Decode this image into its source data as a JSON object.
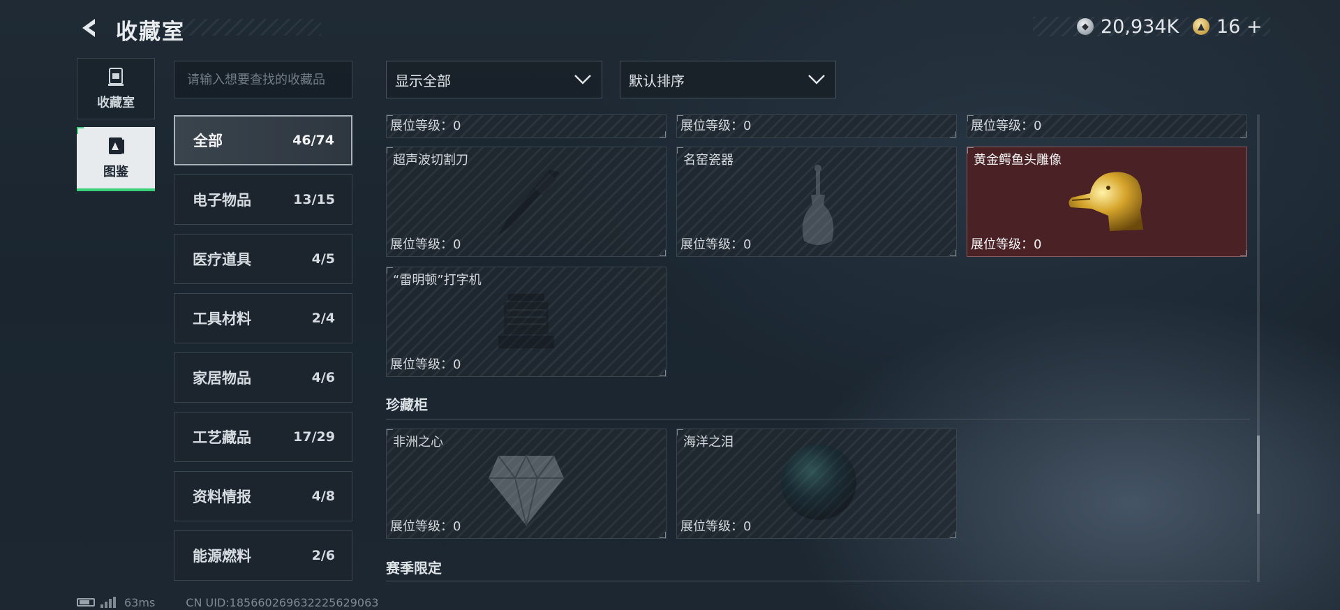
{
  "header": {
    "title": "收藏室",
    "currencies": [
      {
        "icon": "silver-coin-icon",
        "value": "20,934K"
      },
      {
        "icon": "gold-coin-icon",
        "value": "16 +"
      }
    ]
  },
  "left_nav": [
    {
      "icon": "trophy-icon",
      "label": "收藏室",
      "active": false
    },
    {
      "icon": "catalog-icon",
      "label": "图鉴",
      "active": true
    }
  ],
  "search": {
    "placeholder": "请输入想要查找的收藏品",
    "value": ""
  },
  "categories": [
    {
      "name": "全部",
      "count": "46/74",
      "active": true
    },
    {
      "name": "电子物品",
      "count": "13/15"
    },
    {
      "name": "医疗道具",
      "count": "4/5"
    },
    {
      "name": "工具材料",
      "count": "2/4"
    },
    {
      "name": "家居物品",
      "count": "4/6"
    },
    {
      "name": "工艺藏品",
      "count": "17/29"
    },
    {
      "name": "资料情报",
      "count": "4/8"
    },
    {
      "name": "能源燃料",
      "count": "2/6"
    }
  ],
  "filters": {
    "display": {
      "selected": "显示全部"
    },
    "sort": {
      "selected": "默认排序"
    }
  },
  "grid": {
    "level_label": "展位等级：",
    "top_row_levels": [
      "0",
      "0",
      "0"
    ],
    "items": [
      {
        "name": "超声波切割刀",
        "level": "0",
        "owned": false,
        "icon": "knife-icon"
      },
      {
        "name": "名窑瓷器",
        "level": "0",
        "owned": false,
        "icon": "vase-icon"
      },
      {
        "name": "黄金鳄鱼头雕像",
        "level": "0",
        "owned": true,
        "icon": "golden-crocodile-icon"
      },
      {
        "name": "“雷明顿”打字机",
        "level": "0",
        "owned": false,
        "icon": "typewriter-icon"
      }
    ],
    "sections": [
      {
        "title": "珍藏柜",
        "items": [
          {
            "name": "非洲之心",
            "level": "0",
            "owned": false,
            "icon": "diamond-icon"
          },
          {
            "name": "海洋之泪",
            "level": "0",
            "owned": false,
            "icon": "gem-icon"
          }
        ]
      },
      {
        "title": "赛季限定",
        "items": []
      }
    ]
  },
  "footer": {
    "ping": "63ms",
    "uid": "CN UID:18566026963222562906​3"
  }
}
